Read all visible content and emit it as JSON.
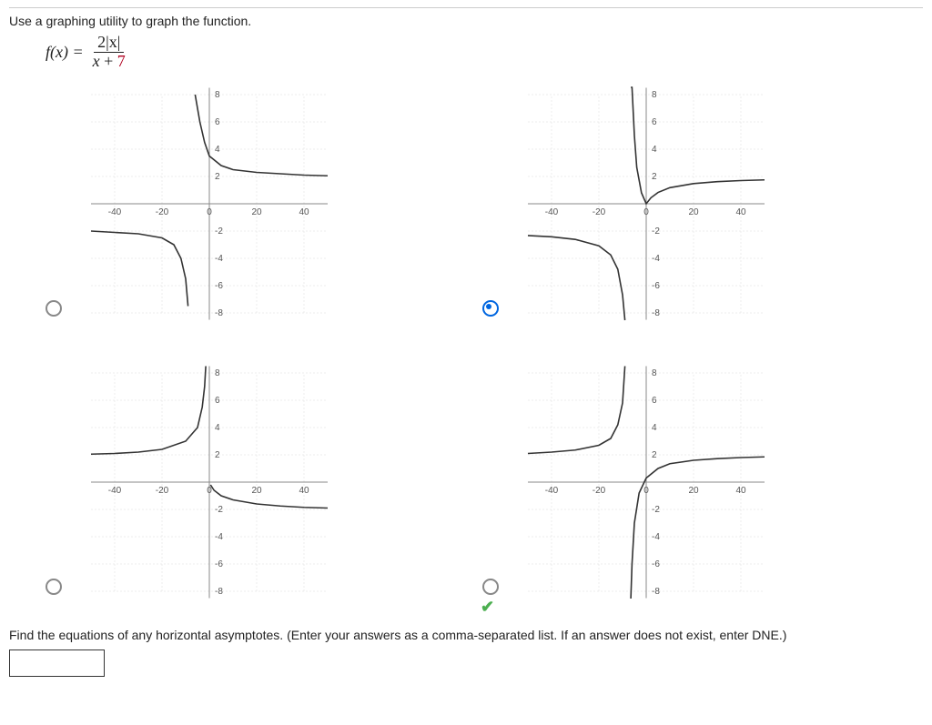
{
  "prompt": "Use a graphing utility to graph the function.",
  "formula": {
    "lhs": "f(x) =",
    "num_two": "2",
    "num_abs": "|x|",
    "den_x": "x",
    "den_plus": " + ",
    "den_seven": "7"
  },
  "options": {
    "a": {
      "selected": false,
      "correct": false
    },
    "b": {
      "selected": true,
      "correct": false
    },
    "c": {
      "selected": false,
      "correct": false
    },
    "d": {
      "selected": false,
      "correct": true
    }
  },
  "axes": {
    "x_ticks": [
      "-40",
      "-20",
      "0",
      "20",
      "40"
    ],
    "y_ticks_pos": [
      "2",
      "4",
      "6",
      "8"
    ],
    "y_ticks_neg": [
      "-2",
      "-4",
      "-6",
      "-8"
    ]
  },
  "asymptote_question": "Find the equations of any horizontal asymptotes. (Enter your answers as a comma-separated list. If an answer does not exist, enter DNE.)",
  "answer_value": "",
  "chart_data": [
    {
      "id": "A",
      "type": "line",
      "xlim": [
        -50,
        50
      ],
      "ylim": [
        -8,
        8
      ],
      "vertical_asymptote": -7,
      "description": "Left branch curving down toward VA at x=-7 from y≈-2; right branch starting near top at x≈-7 going down toward y≈2 as x→∞",
      "series": [
        {
          "name": "left",
          "points": [
            [
              -50,
              -2.0
            ],
            [
              -40,
              -2.1
            ],
            [
              -30,
              -2.2
            ],
            [
              -20,
              -2.5
            ],
            [
              -15,
              -3.0
            ],
            [
              -12,
              -4.0
            ],
            [
              -10,
              -5.5
            ],
            [
              -9,
              -7.5
            ]
          ]
        },
        {
          "name": "right",
          "points": [
            [
              -6,
              8
            ],
            [
              -4,
              6.0
            ],
            [
              -2,
              4.5
            ],
            [
              0,
              3.5
            ],
            [
              5,
              2.8
            ],
            [
              10,
              2.5
            ],
            [
              20,
              2.3
            ],
            [
              40,
              2.1
            ],
            [
              50,
              2.05
            ]
          ]
        }
      ]
    },
    {
      "id": "B",
      "type": "line",
      "xlim": [
        -50,
        50
      ],
      "ylim": [
        -8,
        8
      ],
      "vertical_asymptote": -7,
      "description": "f(x)=2|x|/(x+7): left branch from y≈-2 curving to -∞ at x→-7⁻; right branch from +∞ at x→-7⁺ dipping to 0 at x=0 then rising toward y≈2",
      "series": [
        {
          "name": "left",
          "points": [
            [
              -50,
              -2.33
            ],
            [
              -40,
              -2.42
            ],
            [
              -30,
              -2.61
            ],
            [
              -20,
              -3.08
            ],
            [
              -15,
              -3.75
            ],
            [
              -12,
              -4.8
            ],
            [
              -10,
              -6.67
            ],
            [
              -9,
              -9.0
            ]
          ]
        },
        {
          "name": "right",
          "points": [
            [
              -6.5,
              26
            ],
            [
              -6,
              12
            ],
            [
              -5,
              5
            ],
            [
              -4,
              2.67
            ],
            [
              -2,
              0.8
            ],
            [
              0,
              0
            ],
            [
              2,
              0.44
            ],
            [
              5,
              0.83
            ],
            [
              10,
              1.18
            ],
            [
              20,
              1.48
            ],
            [
              30,
              1.62
            ],
            [
              40,
              1.7
            ],
            [
              50,
              1.75
            ]
          ]
        }
      ]
    },
    {
      "id": "C",
      "type": "line",
      "xlim": [
        -50,
        50
      ],
      "ylim": [
        -8,
        8
      ],
      "vertical_asymptote": 0,
      "description": "Left branch along y≈2 rising to +∞ as x→0⁻; right branch from 0 curving down toward y≈-2",
      "series": [
        {
          "name": "left",
          "points": [
            [
              -50,
              2.05
            ],
            [
              -40,
              2.1
            ],
            [
              -30,
              2.2
            ],
            [
              -20,
              2.4
            ],
            [
              -10,
              3.0
            ],
            [
              -5,
              4.0
            ],
            [
              -3,
              5.5
            ],
            [
              -2,
              7.0
            ],
            [
              -1.5,
              8.5
            ]
          ]
        },
        {
          "name": "right",
          "points": [
            [
              0.5,
              -0.2
            ],
            [
              2,
              -0.6
            ],
            [
              5,
              -1.0
            ],
            [
              10,
              -1.3
            ],
            [
              20,
              -1.6
            ],
            [
              30,
              -1.75
            ],
            [
              40,
              -1.85
            ],
            [
              50,
              -1.9
            ]
          ]
        }
      ]
    },
    {
      "id": "D",
      "type": "line",
      "xlim": [
        -50,
        50
      ],
      "ylim": [
        -8,
        8
      ],
      "vertical_asymptote": -7,
      "description": "Left branch along y≈2 rising to +∞ as x→-7⁻; right branch from -∞ at x→-7⁺ rising through 0 toward y≈2",
      "series": [
        {
          "name": "left",
          "points": [
            [
              -50,
              2.1
            ],
            [
              -40,
              2.2
            ],
            [
              -30,
              2.35
            ],
            [
              -20,
              2.7
            ],
            [
              -15,
              3.2
            ],
            [
              -12,
              4.2
            ],
            [
              -10,
              5.8
            ],
            [
              -9,
              8.5
            ]
          ]
        },
        {
          "name": "right",
          "points": [
            [
              -6.5,
              -9
            ],
            [
              -6,
              -6
            ],
            [
              -5,
              -3
            ],
            [
              -3,
              -0.8
            ],
            [
              0,
              0.3
            ],
            [
              5,
              1.0
            ],
            [
              10,
              1.35
            ],
            [
              20,
              1.6
            ],
            [
              30,
              1.72
            ],
            [
              40,
              1.8
            ],
            [
              50,
              1.85
            ]
          ]
        }
      ]
    }
  ]
}
